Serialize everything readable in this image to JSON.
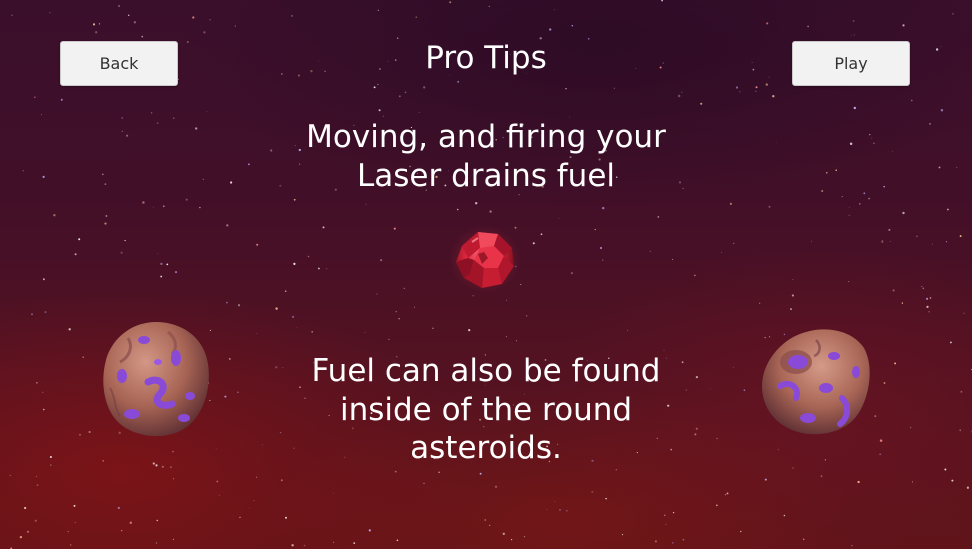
{
  "screen": {
    "title": "Pro Tips"
  },
  "buttons": {
    "back_label": "Back",
    "play_label": "Play"
  },
  "tips": [
    {
      "lines": [
        "Moving, and firing your",
        "Laser drains fuel"
      ]
    },
    {
      "lines": [
        "Fuel can also be found",
        "inside of the round",
        "asteroids."
      ]
    }
  ],
  "sprites": {
    "fuel_pickup": "red-crystal-fuel-icon",
    "asteroids": "purple-spotted-round-asteroid-icon"
  },
  "colors": {
    "background_top": "#3a0f2c",
    "background_bottom": "#5e1419",
    "text": "#ffffff",
    "button_face": "#f2f2f2",
    "button_text": "#333333",
    "fuel_crystal": "#d8243a",
    "asteroid_rock": "#b0705f",
    "asteroid_spots": "#8a4ad8"
  }
}
